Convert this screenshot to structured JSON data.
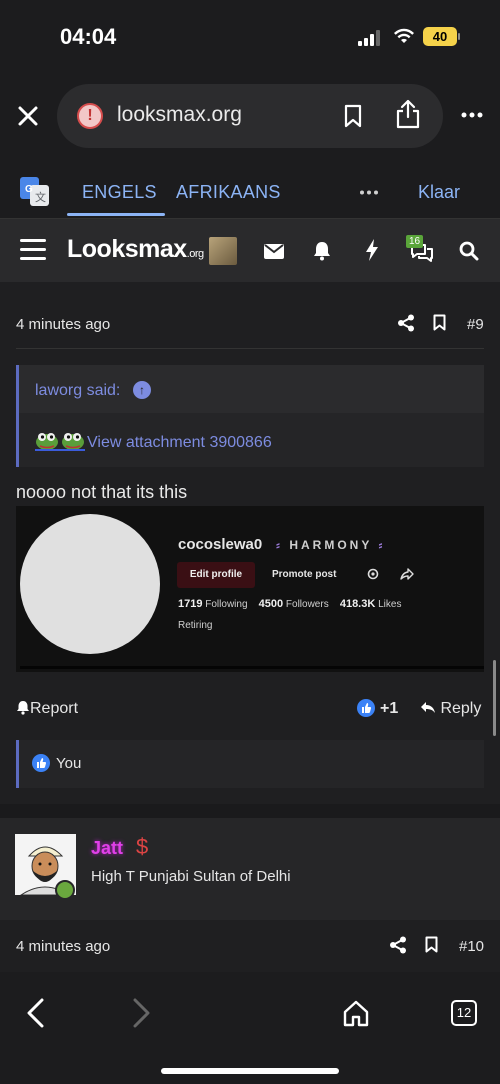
{
  "status_bar": {
    "time": "04:04",
    "battery": "40"
  },
  "browser": {
    "url": "looksmax.org"
  },
  "translate_bar": {
    "lang_active": "ENGELS",
    "lang_other": "AFRIKAANS",
    "done_label": "Klaar"
  },
  "site_header": {
    "logo_main": "Looksmax",
    "logo_suffix": ".org",
    "notification_count": "16"
  },
  "post_9": {
    "time": "4 minutes ago",
    "number": "#9",
    "quote_author": "laworg said:",
    "attachment_link": "View attachment 3900866",
    "text": "noooo not that its this",
    "embed": {
      "username": "cocoslewa0",
      "tag": "HARMONY",
      "edit_profile": "Edit profile",
      "promote": "Promote post",
      "following_count": "1719",
      "following_label": "Following",
      "followers_count": "4500",
      "followers_label": "Followers",
      "likes_count": "418.3K",
      "likes_label": "Likes",
      "bio": "Retiring"
    },
    "report_label": "Report",
    "like_count": "+1",
    "reply_label": "Reply",
    "reaction_users": "You"
  },
  "post_10": {
    "username": "Jatt",
    "user_title": "High T Punjabi Sultan of Delhi",
    "time": "4 minutes ago",
    "number": "#10"
  },
  "bottom_toolbar": {
    "tab_count": "12"
  },
  "colors": {
    "link": "#7d8ce0",
    "translate_accent": "#8cb4f5",
    "like": "#3b82f6",
    "username": "#e040e8",
    "online": "#6aa83e"
  }
}
